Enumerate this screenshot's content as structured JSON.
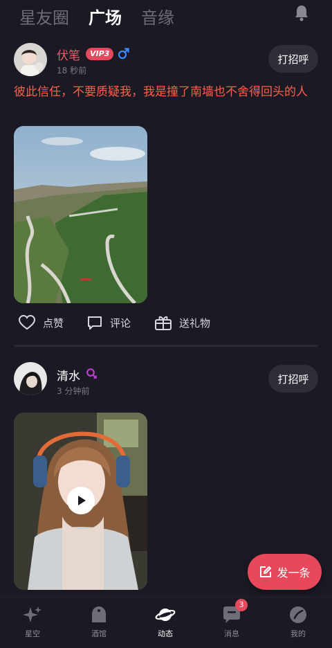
{
  "top_tabs": [
    {
      "label": "星友圈",
      "active": false
    },
    {
      "label": "广场",
      "active": true
    },
    {
      "label": "音缘",
      "active": false
    }
  ],
  "posts": [
    {
      "name": "伏笔",
      "vip_label": "VIP3",
      "gender": "male",
      "time": "18 秒前",
      "greet_label": "打招呼",
      "text": "彼此信任，不要质疑我，我是撞了南墙也不舍得回头的人",
      "media_type": "photo",
      "actions": {
        "like": "点赞",
        "comment": "评论",
        "gift": "送礼物"
      }
    },
    {
      "name": "清水",
      "gender": "female",
      "time": "3 分钟前",
      "greet_label": "打招呼",
      "media_type": "video"
    }
  ],
  "fab_label": "发一条",
  "bottom_nav": [
    {
      "label": "星空",
      "icon": "sparkle-icon",
      "active": false
    },
    {
      "label": "酒馆",
      "icon": "tavern-icon",
      "active": false
    },
    {
      "label": "动态",
      "icon": "planet-icon",
      "active": true
    },
    {
      "label": "消息",
      "icon": "chat-bubble-icon",
      "active": false,
      "badge": "3"
    },
    {
      "label": "我的",
      "icon": "profile-icon",
      "active": false
    }
  ],
  "colors": {
    "background": "#1b1a24",
    "accent": "#e8485c",
    "post_text": "#ff5f4a",
    "male": "#3d8bff",
    "female": "#c23bd4"
  }
}
